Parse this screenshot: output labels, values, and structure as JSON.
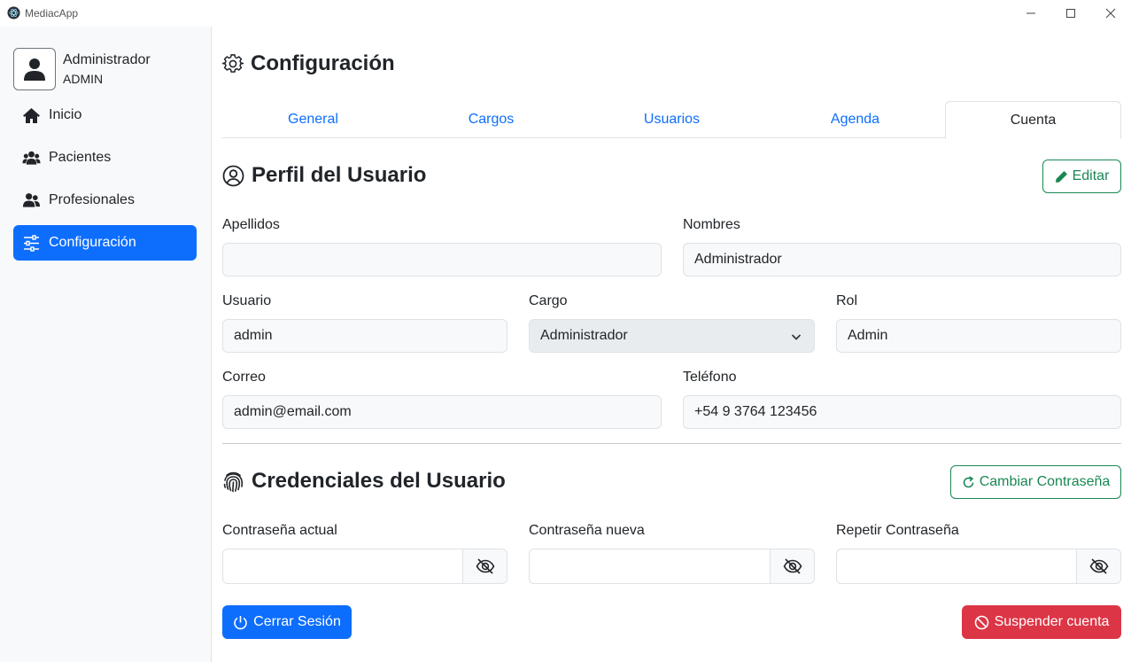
{
  "window": {
    "title": "MediacApp"
  },
  "sidebar": {
    "user": {
      "name": "Administrador",
      "role": "ADMIN"
    },
    "items": [
      {
        "label": "Inicio",
        "icon": "house-icon"
      },
      {
        "label": "Pacientes",
        "icon": "people-icon"
      },
      {
        "label": "Profesionales",
        "icon": "people-pair-icon"
      },
      {
        "label": "Configuración",
        "icon": "sliders-icon",
        "active": true
      }
    ]
  },
  "page": {
    "title": "Configuración"
  },
  "tabs": [
    {
      "label": "General"
    },
    {
      "label": "Cargos"
    },
    {
      "label": "Usuarios"
    },
    {
      "label": "Agenda"
    },
    {
      "label": "Cuenta",
      "active": true
    }
  ],
  "profile": {
    "title": "Perfil del Usuario",
    "edit_label": "Editar",
    "fields": {
      "apellidos": {
        "label": "Apellidos",
        "value": ""
      },
      "nombres": {
        "label": "Nombres",
        "value": "Administrador"
      },
      "usuario": {
        "label": "Usuario",
        "value": "admin"
      },
      "cargo": {
        "label": "Cargo",
        "value": "Administrador"
      },
      "rol": {
        "label": "Rol",
        "value": "Admin"
      },
      "correo": {
        "label": "Correo",
        "value": "admin@email.com"
      },
      "telefono": {
        "label": "Teléfono",
        "value": "+54 9 3764 123456"
      }
    }
  },
  "credentials": {
    "title": "Credenciales del Usuario",
    "change_label": "Cambiar Contraseña",
    "current_label": "Contraseña actual",
    "new_label": "Contraseña nueva",
    "repeat_label": "Repetir Contraseña"
  },
  "actions": {
    "logout_label": "Cerrar Sesión",
    "suspend_label": "Suspender cuenta"
  },
  "colors": {
    "primary": "#0d6efd",
    "success": "#198754",
    "danger": "#dc3545",
    "sidebar_bg": "#f8f9fa"
  }
}
